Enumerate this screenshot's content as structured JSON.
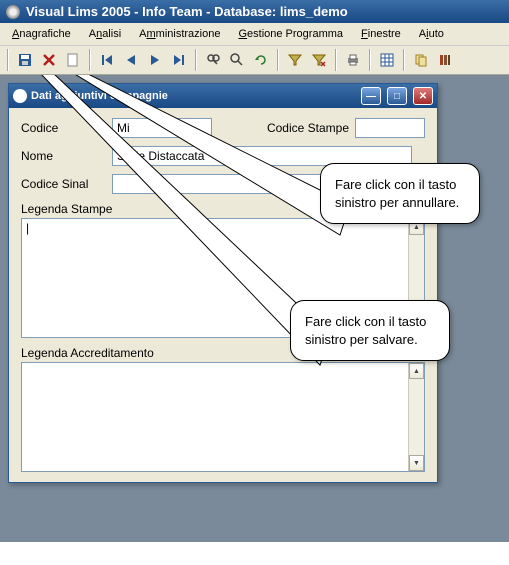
{
  "window": {
    "title": "Visual Lims 2005 - Info Team - Database: lims_demo"
  },
  "menu": {
    "anagrafiche": "Anagrafiche",
    "analisi": "Analisi",
    "amministrazione": "Amministrazione",
    "gestione": "Gestione Programma",
    "finestre": "Finestre",
    "aiuto": "Aiuto"
  },
  "child": {
    "title": "Dati aggiuntivi compagnie",
    "labels": {
      "codice": "Codice",
      "nome": "Nome",
      "codice_sinal": "Codice Sinal",
      "codice_stampe": "Codice Stampe",
      "legenda_stampe": "Legenda Stampe",
      "legenda_accred": "Legenda Accreditamento"
    },
    "values": {
      "codice": "Mi",
      "nome": "Sede Distaccata",
      "codice_sinal": "",
      "codice_stampe": "",
      "legenda_stampe": "|",
      "legenda_accred": ""
    }
  },
  "callouts": {
    "cancel": "Fare click con il tasto sinistro per annullare.",
    "save": "Fare click con il tasto sinistro per salvare."
  }
}
